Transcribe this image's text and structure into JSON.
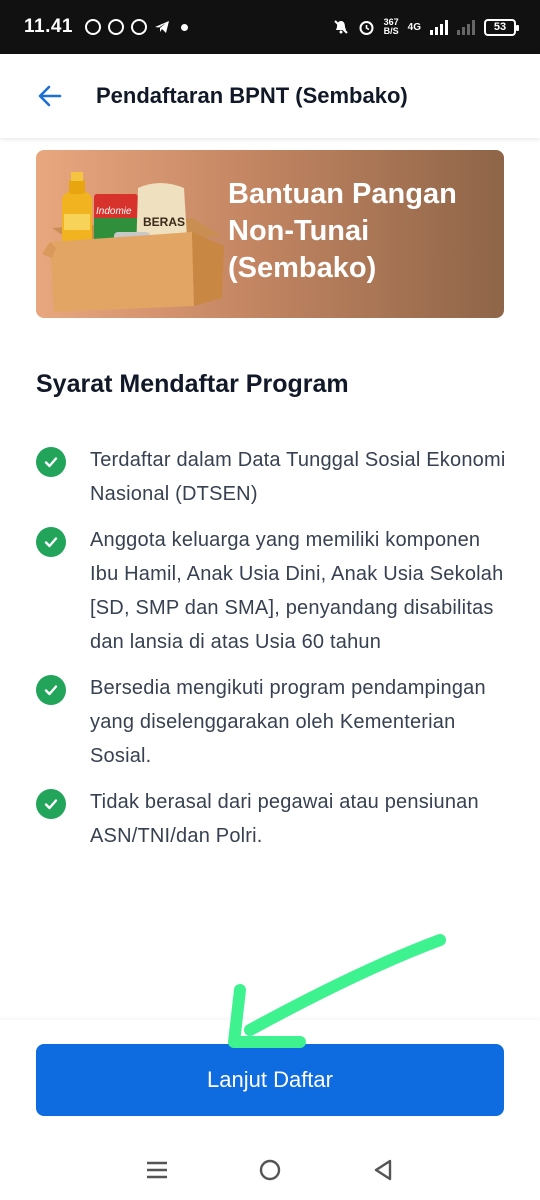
{
  "status_bar": {
    "time": "11.41",
    "net_speed_value": "367",
    "net_speed_unit": "B/S",
    "network": "4G",
    "battery": "53",
    "icons": [
      "whatsapp-icon",
      "whatsapp-business-icon",
      "vpn-icon",
      "telegram-icon",
      "mute-icon",
      "alarm-icon",
      "signal-icon",
      "battery-icon"
    ]
  },
  "header": {
    "title": "Pendaftaran BPNT (Sembako)",
    "back_icon": "arrow-left-icon"
  },
  "banner": {
    "title": "Bantuan Pangan Non-Tunai (Sembako)",
    "label_indomie": "Indomie",
    "label_beras": "BERAS"
  },
  "requirements": {
    "heading": "Syarat Mendaftar Program",
    "items": [
      "Terdaftar dalam Data Tunggal Sosial Ekonomi Nasional (DTSEN)",
      "Anggota keluarga yang memiliki komponen Ibu Hamil, Anak Usia Dini, Anak Usia Sekolah [SD, SMP dan SMA], penyandang disabilitas dan lansia di atas Usia 60 tahun",
      "Bersedia mengikuti program pendampingan yang diselenggarakan oleh Kementerian Sosial.",
      "Tidak berasal dari pegawai atau pensiunan ASN/TNI/dan Polri."
    ]
  },
  "footer": {
    "button_label": "Lanjut Daftar"
  },
  "colors": {
    "primary": "#0f6ce0",
    "check": "#22a45a",
    "arrow_overlay": "#3df28f"
  }
}
